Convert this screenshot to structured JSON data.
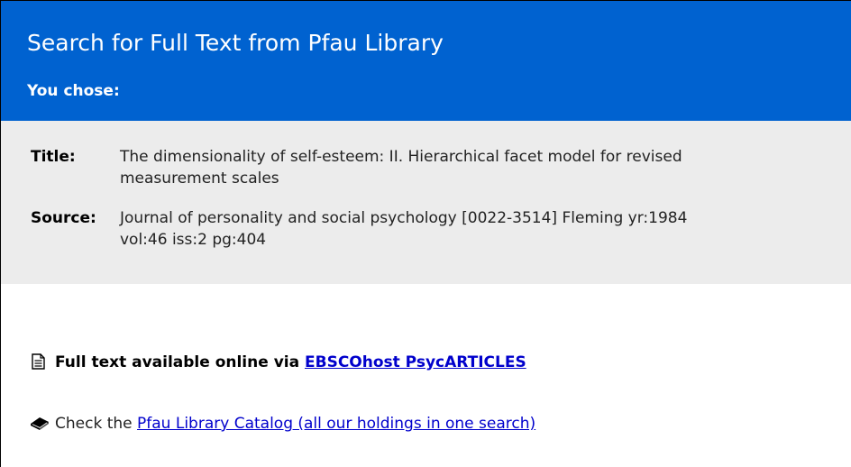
{
  "header": {
    "title": "Search for Full Text from Pfau Library",
    "subtitle": "You chose:"
  },
  "citation": {
    "title_label": "Title:",
    "title_value": "The dimensionality of self-esteem: II. Hierarchical facet model for revised\nmeasurement scales",
    "source_label": "Source:",
    "source_value": "Journal of personality and social psychology [0022-3514] Fleming yr:1984\nvol:46 iss:2 pg:404"
  },
  "options": {
    "fulltext_prefix": "Full text available online via ",
    "fulltext_link": "EBSCOhost PsycARTICLES",
    "fulltext_icon": "document-icon",
    "catalog_prefix": "Check the ",
    "catalog_link": "Pfau Library Catalog (all our holdings in one search)",
    "catalog_icon": "book-icon"
  },
  "colors": {
    "banner": "#0062d0",
    "citation_background": "#ececec",
    "link": "#0000cc"
  }
}
